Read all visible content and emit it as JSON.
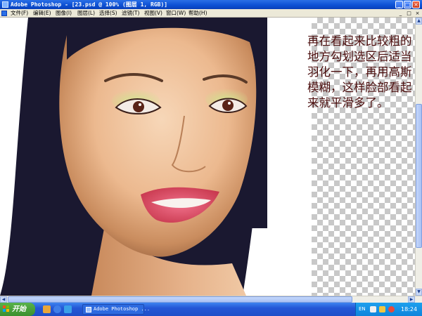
{
  "window": {
    "title": "Adobe Photoshop - [23.psd @ 100% (图层 1, RGB)]",
    "minimize": "_",
    "maximize": "□",
    "close": "×"
  },
  "menu": {
    "items": [
      "文件(F)",
      "编辑(E)",
      "图像(I)",
      "图层(L)",
      "选择(S)",
      "滤镜(T)",
      "视图(V)",
      "窗口(W)",
      "帮助(H)"
    ],
    "controls": [
      "_",
      "□",
      "×"
    ]
  },
  "canvas": {
    "caption": "再在看起来比较粗的地方勾划选区后适当羽化一下，再用高斯模糊，这样脸部看起来就平滑多了。"
  },
  "scrollbars": {
    "vertical_thumb_position": 0.35,
    "horizontal_thumb_position": 0.0
  },
  "taskbar": {
    "start_label": "开始",
    "task_label": "Adobe Photoshop ...",
    "language": "EN",
    "clock": "18:24"
  },
  "colors": {
    "title_bar": "#0b4fd3",
    "caption_text": "#4a0c0c",
    "taskbar": "#2457d6",
    "start_button": "#3b8f2e"
  }
}
